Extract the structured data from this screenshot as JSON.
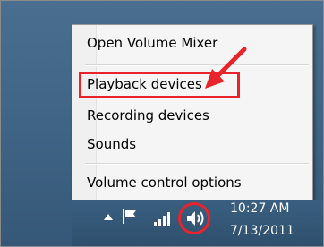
{
  "context_menu": {
    "items": [
      {
        "label": "Open Volume Mixer"
      },
      {
        "label": "Playback devices"
      },
      {
        "label": "Recording devices"
      },
      {
        "label": "Sounds"
      },
      {
        "label": "Volume control options"
      }
    ]
  },
  "tray": {
    "icons": [
      "chevron-up-icon",
      "flag-icon",
      "network-signal-icon",
      "speaker-icon"
    ]
  },
  "clock": {
    "time": "10:27 AM",
    "date": "7/13/2011"
  },
  "annotation_color": "#e8232b"
}
